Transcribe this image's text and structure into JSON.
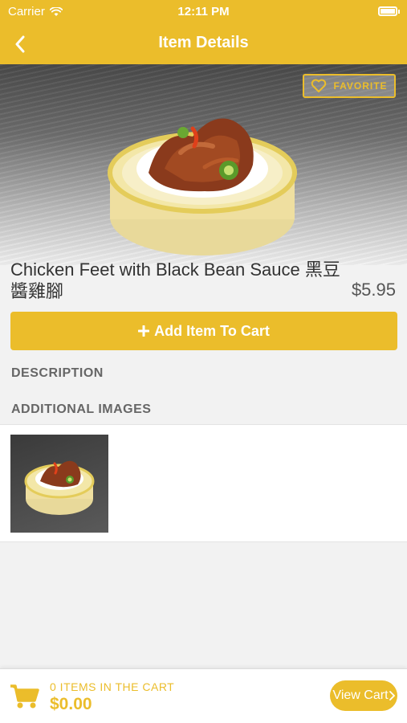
{
  "status_bar": {
    "carrier": "Carrier",
    "time": "12:11 PM"
  },
  "nav": {
    "title": "Item Details"
  },
  "favorite": {
    "label": "FAVORITE"
  },
  "item": {
    "name": "Chicken Feet with Black Bean Sauce 黑豆醬雞腳",
    "price": "$5.95"
  },
  "add_to_cart": {
    "label": "Add Item To Cart"
  },
  "sections": {
    "description": "DESCRIPTION",
    "additional_images": "ADDITIONAL IMAGES"
  },
  "cart": {
    "count_text": "0 ITEMS IN THE CART",
    "total": "$0.00",
    "view_label": "View Cart"
  },
  "colors": {
    "accent": "#ebbd2b",
    "background": "#f2f2f2"
  },
  "icons": [
    "wifi-icon",
    "battery-icon",
    "back-chevron-icon",
    "heart-icon",
    "plus-icon",
    "cart-icon",
    "chevron-right-icon"
  ]
}
